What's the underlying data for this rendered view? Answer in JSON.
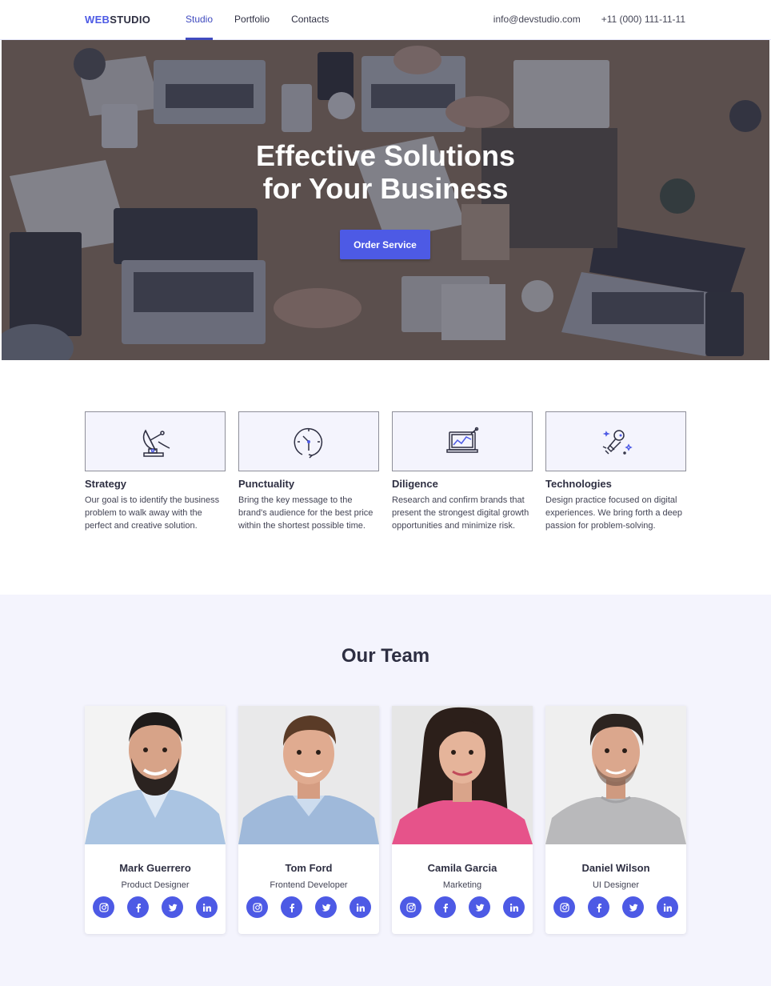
{
  "header": {
    "logo_part1": "WEB",
    "logo_part2": "STUDIO",
    "nav": [
      {
        "label": "Studio",
        "active": true
      },
      {
        "label": "Portfolio",
        "active": false
      },
      {
        "label": "Contacts",
        "active": false
      }
    ],
    "email": "info@devstudio.com",
    "phone": "+11 (000) 111-11-11"
  },
  "hero": {
    "title_line1": "Effective Solutions",
    "title_line2": "for Your Business",
    "button_label": "Order Service"
  },
  "features": [
    {
      "icon": "satellite-dish-icon",
      "title": "Strategy",
      "text": "Our goal is to identify the business problem to walk away with the perfect and creative solution."
    },
    {
      "icon": "clock-icon",
      "title": "Punctuality",
      "text": "Bring the key message to the brand's audience for the best price within the shortest possible time."
    },
    {
      "icon": "laptop-chart-icon",
      "title": "Diligence",
      "text": "Research and confirm brands that present the strongest digital growth opportunities and minimize risk."
    },
    {
      "icon": "astronaut-icon",
      "title": "Technologies",
      "text": "Design practice focused on digital experiences. We bring forth a deep passion for problem-solving."
    }
  ],
  "team": {
    "title": "Our Team",
    "members": [
      {
        "name": "Mark Guerrero",
        "role": "Product Designer"
      },
      {
        "name": "Tom Ford",
        "role": "Frontend Developer"
      },
      {
        "name": "Camila Garcia",
        "role": "Marketing"
      },
      {
        "name": "Daniel Wilson",
        "role": "UI Designer"
      }
    ],
    "social_icons": [
      "instagram-icon",
      "facebook-icon",
      "twitter-icon",
      "linkedin-icon"
    ]
  },
  "colors": {
    "accent": "#4d5ae5",
    "nav_active": "#404bbf",
    "dark_text": "#2e2f42",
    "body_text": "#434455",
    "section_bg": "#f4f4fd"
  }
}
